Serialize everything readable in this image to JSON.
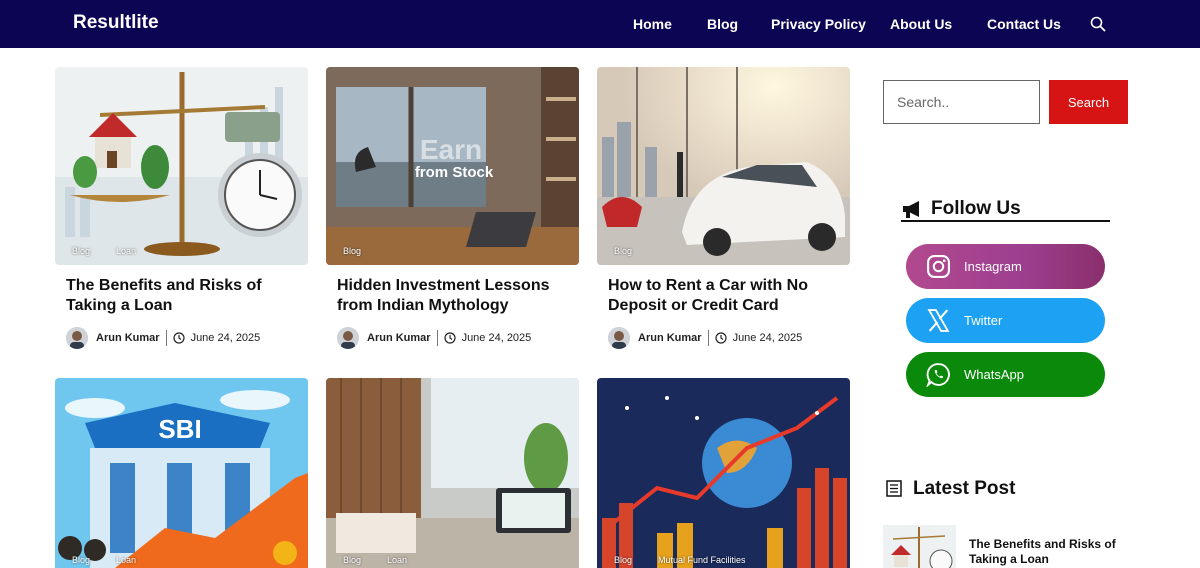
{
  "header": {
    "logo": "Resultlite",
    "nav": [
      "Home",
      "Blog",
      "Privacy Policy",
      "About Us",
      "Contact Us"
    ],
    "search_icon": "search-icon"
  },
  "posts": [
    {
      "title": "The Benefits and Risks of Taking a Loan",
      "author": "Arun Kumar",
      "date": "June 24, 2025",
      "categories": [
        "Blog",
        "Loan"
      ]
    },
    {
      "title": "Hidden Investment Lessons from Indian Mythology",
      "author": "Arun Kumar",
      "date": "June 24, 2025",
      "categories": [
        "Blog"
      ],
      "image_text": [
        "Earn",
        "from Stock"
      ]
    },
    {
      "title": "How to Rent a Car with No Deposit or Credit Card",
      "author": "Arun Kumar",
      "date": "June 24, 2025",
      "categories": [
        "Blog"
      ]
    },
    {
      "title": "",
      "categories": [
        "Blog",
        "Loan"
      ],
      "image_text": [
        "SBI"
      ]
    },
    {
      "title": "",
      "categories": [
        "Blog",
        "Loan"
      ]
    },
    {
      "title": "",
      "categories": [
        "Blog",
        "Mutual Fund Facilities"
      ]
    }
  ],
  "sidebar": {
    "search": {
      "placeholder": "Search..",
      "button": "Search"
    },
    "follow": {
      "title": "Follow Us",
      "links": [
        {
          "label": "Instagram",
          "icon": "instagram-icon",
          "color": "#a8428f"
        },
        {
          "label": "Twitter",
          "icon": "x-icon",
          "color": "#1da1f2"
        },
        {
          "label": "WhatsApp",
          "icon": "whatsapp-icon",
          "color": "#0a890a"
        }
      ]
    },
    "latest": {
      "title": "Latest Post",
      "items": [
        {
          "title": "The Benefits and Risks of Taking a Loan"
        }
      ]
    }
  },
  "colors": {
    "header_bg": "#0c0554",
    "search_button": "#d71414"
  }
}
